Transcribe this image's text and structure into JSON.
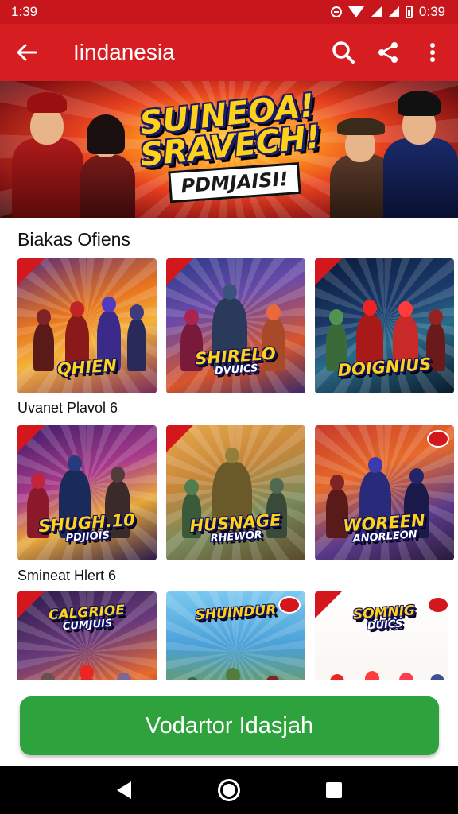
{
  "status_bar": {
    "time_left": "1:39",
    "time_right": "0:39"
  },
  "app_bar": {
    "title": "Iindanesia"
  },
  "banner": {
    "line1": "SUINEOA!",
    "line2": "SRAVECH!",
    "line3": "PDMJAISI!"
  },
  "sections": [
    {
      "title": "Biakas Ofiens",
      "cards": [
        {
          "title": "QHIEN",
          "subtitle": ""
        },
        {
          "title": "SHIRELO",
          "subtitle": "DVUICS"
        },
        {
          "title": "DOIGNIUS",
          "subtitle": ""
        }
      ]
    },
    {
      "title": "Uvanet Plavol 6",
      "cards": [
        {
          "title": "SHUGH.10",
          "subtitle": "PDJIOIS"
        },
        {
          "title": "HUSNAGE",
          "subtitle": "RHEWOR"
        },
        {
          "title": "WOREEN",
          "subtitle": "ANORLEON"
        }
      ]
    },
    {
      "title": "Smineat Hlert 6",
      "cards": [
        {
          "title": "CALGRIOE",
          "subtitle": "CUMJUIS"
        },
        {
          "title": "SHUINDUR",
          "subtitle": ""
        },
        {
          "title": "SOMNIG",
          "subtitle": "DUICS"
        }
      ]
    }
  ],
  "cta": {
    "label": "Vodartor Idasjah"
  },
  "colors": {
    "status_bar": "#c8161d",
    "app_bar": "#d61e22",
    "cta": "#2ea23c",
    "nav_bar": "#000000"
  },
  "icons": {
    "back": "arrow-left-icon",
    "search": "search-icon",
    "share": "share-icon",
    "more": "more-vert-icon"
  }
}
